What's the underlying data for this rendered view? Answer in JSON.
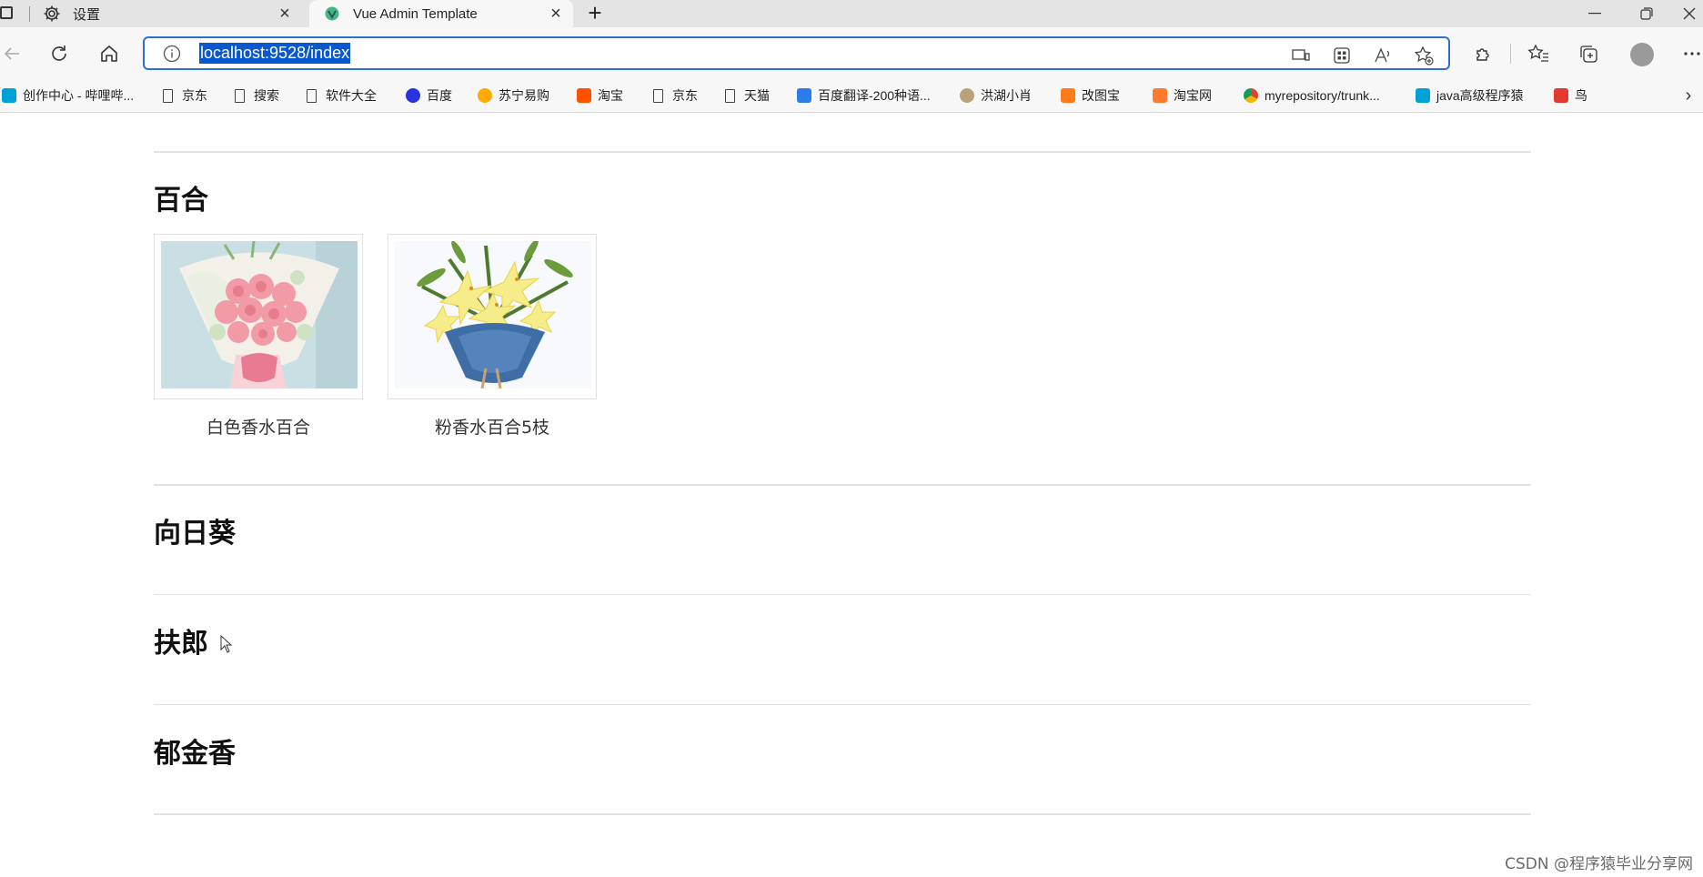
{
  "browser": {
    "tabs": [
      {
        "title": "设置",
        "icon": "gear-icon",
        "active": false
      },
      {
        "title": "Vue Admin Template",
        "icon": "vue-logo-icon",
        "active": true
      }
    ],
    "address": {
      "url": "localhost:9528/index"
    },
    "bookmarks": [
      {
        "label": "创作中心 - 哔哩哔...",
        "icon": "bilibili-icon"
      },
      {
        "label": "京东",
        "icon": "page-icon"
      },
      {
        "label": "搜索",
        "icon": "page-icon"
      },
      {
        "label": "软件大全",
        "icon": "page-icon"
      },
      {
        "label": "百度",
        "icon": "baidu-icon"
      },
      {
        "label": "苏宁易购",
        "icon": "suning-icon"
      },
      {
        "label": "淘宝",
        "icon": "taobao-icon"
      },
      {
        "label": "京东",
        "icon": "page-icon"
      },
      {
        "label": "天猫",
        "icon": "page-icon"
      },
      {
        "label": "百度翻译-200种语...",
        "icon": "translate-icon"
      },
      {
        "label": "洪湖小肖",
        "icon": "hawk-icon"
      },
      {
        "label": "改图宝",
        "icon": "gaitubao-icon"
      },
      {
        "label": "淘宝网",
        "icon": "taobao-icon"
      },
      {
        "label": "myrepository/trunk...",
        "icon": "chrome-icon"
      },
      {
        "label": "java高级程序猿",
        "icon": "bilibili-icon"
      },
      {
        "label": "鸟",
        "icon": "bird-icon"
      }
    ],
    "colors": {
      "accent": "#2e6fd6",
      "selection": "#0a58d0"
    }
  },
  "page": {
    "categories": [
      {
        "title": "百合",
        "products": [
          {
            "name": "白色香水百合"
          },
          {
            "name": "粉香水百合5枝"
          }
        ]
      },
      {
        "title": "向日葵",
        "products": []
      },
      {
        "title": "扶郎",
        "products": []
      },
      {
        "title": "郁金香",
        "products": []
      }
    ]
  },
  "watermark": "CSDN @程序猿毕业分享网"
}
